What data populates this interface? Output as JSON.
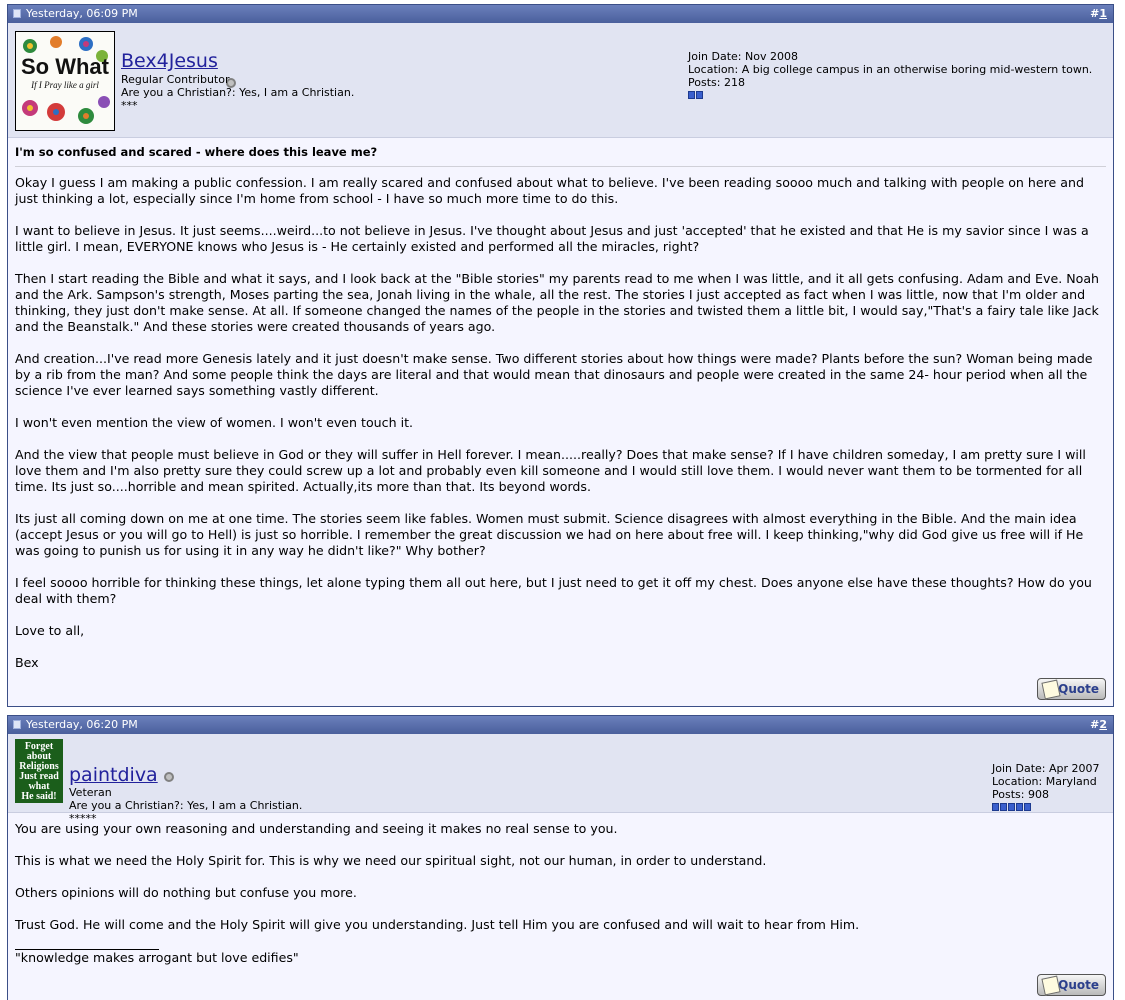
{
  "posts": [
    {
      "date": "Yesterday, 06:09 PM",
      "number_prefix": "#",
      "number": "1",
      "username": "Bex4Jesus",
      "user_title": "Regular Contributor",
      "religion": "Are you a Christian?: Yes, I am a Christian.",
      "stars": "***",
      "join_date": "Join Date: Nov 2008",
      "location": "Location: A big college campus in an otherwise boring mid-western town.",
      "posts_count": "Posts: 218",
      "avatar_text": [
        "So What",
        "If I Pray like a girl"
      ],
      "title": "I'm so confused and scared - where does this leave me?",
      "paragraphs": [
        "Okay I guess I am making a public confession. I am really scared and confused about what to believe. I've been reading soooo much and talking with people on here and just thinking a lot, especially since I'm home from school - I have so much more time to do this.",
        "I want to believe in Jesus. It just seems....weird...to not believe in Jesus. I've thought about Jesus and just 'accepted' that he existed and that He is my savior since I was a little girl. I mean, EVERYONE knows who Jesus is - He certainly existed and performed all the miracles, right?",
        "Then I start reading the Bible and what it says, and I look back at the \"Bible stories\" my parents read to me when I was little, and it all gets confusing. Adam and Eve. Noah and the Ark. Sampson's strength, Moses parting the sea, Jonah living in the whale, all the rest. The stories I just accepted as fact when I was little, now that I'm older and thinking, they just don't make sense. At all. If someone changed the names of the people in the stories and twisted them a little bit, I would say,\"That's a fairy tale like Jack and the Beanstalk.\" And these stories were created thousands of years ago.",
        "And creation...I've read more Genesis lately and it just doesn't make sense. Two different stories about how things were made? Plants before the sun? Woman being made by a rib from the man? And some people think the days are literal and that would mean that dinosaurs and people were created in the same 24- hour period when all the science I've ever learned says something vastly different.",
        "I won't even mention the view of women. I won't even touch it.",
        "And the view that people must believe in God or they will suffer in Hell forever. I mean.....really? Does that make sense? If I have children someday, I am pretty sure I will love them and I'm also pretty sure they could screw up a lot and probably even kill someone and I would still love them. I would never want them to be tormented for all time. Its just so....horrible and mean spirited. Actually,its more than that. Its beyond words.",
        "Its just all coming down on me at one time. The stories seem like fables. Women must submit. Science disagrees with almost everything in the Bible. And the main idea (accept Jesus or you will go to Hell) is just so horrible. I remember the great discussion we had on here about free will. I keep thinking,\"why did God give us free will if He was going to punish us for using it in any way he didn't like?\" Why bother?",
        "I feel soooo horrible for thinking these things, let alone typing them all out here, but I just need to get it off my chest. Does anyone else have these thoughts? How do you deal with them?",
        "Love to all,",
        "Bex"
      ],
      "quote_label": "Quote"
    },
    {
      "date": "Yesterday, 06:20 PM",
      "number_prefix": "#",
      "number": "2",
      "username": "paintdiva",
      "user_title": "Veteran",
      "religion": "Are you a Christian?: Yes, I am a Christian.",
      "stars": "*****",
      "join_date": "Join Date: Apr 2007",
      "location": "Location: Maryland",
      "posts_count": "Posts: 908",
      "avatar_text": [
        "Forget",
        "about",
        "Religions",
        "Just read",
        "what",
        "He said!"
      ],
      "paragraphs": [
        "You are using your own reasoning and understanding and seeing it makes no real sense to you.",
        "This is what we need the Holy Spirit for. This is why we need our spiritual sight, not our human, in order to understand.",
        "Others opinions will do nothing but confuse you more.",
        "Trust God. He will come and the Holy Spirit will give you understanding. Just tell Him you are confused and will wait to hear from Him."
      ],
      "signature": "\"knowledge makes arrogant but love edifies\"",
      "quote_label": "Quote"
    }
  ],
  "colors": {
    "header": "#5268a8",
    "userbar": "#e1e4f2",
    "post_bg": "#f5f5ff",
    "username": "#22229c",
    "rep": "#3a5fcd"
  },
  "icons": [
    "post-document-icon",
    "offline-status-icon",
    "reputation-icon",
    "quote-pencil-icon"
  ]
}
